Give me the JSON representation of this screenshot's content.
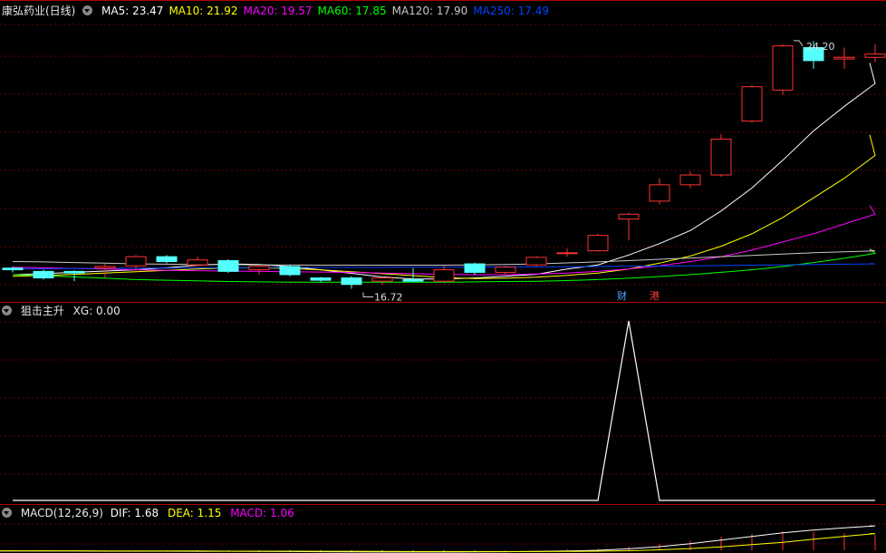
{
  "main_panel": {
    "title": "康弘药业(日线)",
    "ma_legend": [
      {
        "label": "MA5: 23.47",
        "color": "#ffffff"
      },
      {
        "label": "MA10: 21.92",
        "color": "#ffff00"
      },
      {
        "label": "MA20: 19.57",
        "color": "#ff00ff"
      },
      {
        "label": "MA60: 17.85",
        "color": "#00ff00"
      },
      {
        "label": "MA120: 17.90",
        "color": "#c8c8c8"
      },
      {
        "label": "MA250: 17.49",
        "color": "#0044ff"
      }
    ],
    "high_label": "24.20",
    "low_label": "16.72",
    "event_tags": [
      {
        "text": "财",
        "color": "#4aa8ff"
      },
      {
        "text": "港",
        "color": "#ff4040"
      }
    ]
  },
  "indicator_panel": {
    "title": "狙击主升",
    "value_label": "XG: 0.00"
  },
  "macd_panel": {
    "title": "MACD(12,26,9)",
    "dif_label": "DIF: 1.68",
    "dea_label": "DEA: 1.15",
    "macd_label": "MACD: 1.06"
  },
  "chart_data": [
    {
      "type": "candlestick",
      "title": "康弘药业(日线)",
      "price_range": [
        16.4,
        25.0
      ],
      "candles": [
        {
          "o": 17.35,
          "h": 17.4,
          "l": 17.22,
          "c": 17.3
        },
        {
          "o": 17.25,
          "h": 17.3,
          "l": 17.0,
          "c": 17.05
        },
        {
          "o": 17.25,
          "h": 17.28,
          "l": 16.95,
          "c": 17.2
        },
        {
          "o": 17.35,
          "h": 17.5,
          "l": 17.05,
          "c": 17.4
        },
        {
          "o": 17.42,
          "h": 17.75,
          "l": 17.3,
          "c": 17.7
        },
        {
          "o": 17.7,
          "h": 17.75,
          "l": 17.5,
          "c": 17.55
        },
        {
          "o": 17.45,
          "h": 17.7,
          "l": 17.4,
          "c": 17.6
        },
        {
          "o": 17.58,
          "h": 17.62,
          "l": 17.2,
          "c": 17.25
        },
        {
          "o": 17.3,
          "h": 17.45,
          "l": 17.15,
          "c": 17.4
        },
        {
          "o": 17.4,
          "h": 17.45,
          "l": 17.1,
          "c": 17.15
        },
        {
          "o": 17.05,
          "h": 17.08,
          "l": 16.92,
          "c": 16.98
        },
        {
          "o": 17.05,
          "h": 17.1,
          "l": 16.72,
          "c": 16.85
        },
        {
          "o": 16.95,
          "h": 17.1,
          "l": 16.85,
          "c": 17.05
        },
        {
          "o": 17.0,
          "h": 17.35,
          "l": 16.92,
          "c": 16.95
        },
        {
          "o": 16.95,
          "h": 17.42,
          "l": 16.88,
          "c": 17.3
        },
        {
          "o": 17.48,
          "h": 17.52,
          "l": 17.15,
          "c": 17.22
        },
        {
          "o": 17.22,
          "h": 17.42,
          "l": 17.15,
          "c": 17.38
        },
        {
          "o": 17.45,
          "h": 17.72,
          "l": 17.4,
          "c": 17.68
        },
        {
          "o": 17.8,
          "h": 17.95,
          "l": 17.7,
          "c": 17.82
        },
        {
          "o": 17.88,
          "h": 18.4,
          "l": 17.85,
          "c": 18.35
        },
        {
          "o": 18.85,
          "h": 19.05,
          "l": 18.2,
          "c": 19.0
        },
        {
          "o": 19.4,
          "h": 20.1,
          "l": 19.3,
          "c": 19.9
        },
        {
          "o": 19.9,
          "h": 20.3,
          "l": 19.8,
          "c": 20.2
        },
        {
          "o": 20.2,
          "h": 21.45,
          "l": 20.15,
          "c": 21.3
        },
        {
          "o": 21.85,
          "h": 22.95,
          "l": 21.8,
          "c": 22.9
        },
        {
          "o": 22.8,
          "h": 24.2,
          "l": 22.65,
          "c": 24.15
        },
        {
          "o": 24.1,
          "h": 24.3,
          "l": 23.45,
          "c": 23.7
        },
        {
          "o": 23.75,
          "h": 24.1,
          "l": 23.45,
          "c": 23.8
        },
        {
          "o": 23.8,
          "h": 24.2,
          "l": 23.65,
          "c": 23.9
        }
      ],
      "series": [
        {
          "name": "MA5",
          "color": "#ffffff",
          "values": [
            17.15,
            17.18,
            17.22,
            17.26,
            17.3,
            17.36,
            17.44,
            17.48,
            17.46,
            17.4,
            17.3,
            17.19,
            17.08,
            17.02,
            17.02,
            17.05,
            17.1,
            17.16,
            17.32,
            17.45,
            17.75,
            18.1,
            18.5,
            19.1,
            19.8,
            20.65,
            21.55,
            22.3,
            23.0
          ]
        },
        {
          "name": "MA10",
          "color": "#ffff00",
          "values": [
            17.1,
            17.12,
            17.16,
            17.2,
            17.24,
            17.28,
            17.32,
            17.36,
            17.36,
            17.34,
            17.3,
            17.24,
            17.18,
            17.12,
            17.06,
            17.03,
            17.04,
            17.07,
            17.13,
            17.2,
            17.32,
            17.5,
            17.72,
            18.02,
            18.4,
            18.9,
            19.5,
            20.1,
            20.8
          ]
        },
        {
          "name": "MA20",
          "color": "#ff00ff",
          "values": [
            17.38,
            17.36,
            17.34,
            17.32,
            17.3,
            17.28,
            17.27,
            17.26,
            17.25,
            17.24,
            17.23,
            17.22,
            17.2,
            17.18,
            17.16,
            17.15,
            17.15,
            17.17,
            17.2,
            17.25,
            17.32,
            17.42,
            17.55,
            17.7,
            17.9,
            18.15,
            18.4,
            18.7,
            19.0
          ]
        },
        {
          "name": "MA60",
          "color": "#00ff00",
          "values": [
            17.15,
            17.12,
            17.08,
            17.04,
            17.0,
            16.98,
            16.96,
            16.94,
            16.93,
            16.92,
            16.92,
            16.92,
            16.92,
            16.92,
            16.92,
            16.93,
            16.94,
            16.95,
            16.97,
            17.0,
            17.04,
            17.09,
            17.15,
            17.22,
            17.3,
            17.4,
            17.52,
            17.65,
            17.8
          ]
        },
        {
          "name": "MA120",
          "color": "#c8c8c8",
          "values": [
            17.55,
            17.54,
            17.52,
            17.5,
            17.48,
            17.47,
            17.46,
            17.46,
            17.45,
            17.45,
            17.44,
            17.44,
            17.44,
            17.44,
            17.44,
            17.45,
            17.46,
            17.48,
            17.51,
            17.54,
            17.58,
            17.62,
            17.66,
            17.7,
            17.74,
            17.78,
            17.82,
            17.85,
            17.88
          ]
        },
        {
          "name": "MA250",
          "color": "#0044ff",
          "values": [
            17.33,
            17.33,
            17.34,
            17.34,
            17.35,
            17.35,
            17.36,
            17.36,
            17.36,
            17.37,
            17.37,
            17.37,
            17.37,
            17.38,
            17.38,
            17.38,
            17.39,
            17.39,
            17.39,
            17.4,
            17.41,
            17.41,
            17.42,
            17.43,
            17.44,
            17.45,
            17.46,
            17.47,
            17.48
          ]
        }
      ]
    },
    {
      "type": "line",
      "title": "狙击主升",
      "series": [
        {
          "name": "XG",
          "color": "#ffffff",
          "values": [
            0,
            0,
            0,
            0,
            0,
            0,
            0,
            0,
            0,
            0,
            0,
            0,
            0,
            0,
            0,
            0,
            0,
            0,
            0,
            0,
            1,
            0,
            0,
            0,
            0,
            0,
            0,
            0,
            0
          ]
        }
      ],
      "ylim": [
        0,
        1
      ]
    },
    {
      "type": "line",
      "title": "MACD(12,26,9)",
      "series": [
        {
          "name": "DIF",
          "color": "#ffffff",
          "values": [
            -0.05,
            -0.05,
            -0.05,
            -0.06,
            -0.06,
            -0.06,
            -0.07,
            -0.07,
            -0.08,
            -0.09,
            -0.1,
            -0.11,
            -0.12,
            -0.12,
            -0.12,
            -0.11,
            -0.1,
            -0.08,
            -0.05,
            0.0,
            0.1,
            0.25,
            0.45,
            0.7,
            0.95,
            1.2,
            1.4,
            1.55,
            1.68
          ]
        },
        {
          "name": "DEA",
          "color": "#ffff00",
          "values": [
            -0.04,
            -0.04,
            -0.04,
            -0.05,
            -0.05,
            -0.05,
            -0.05,
            -0.06,
            -0.06,
            -0.06,
            -0.07,
            -0.07,
            -0.08,
            -0.09,
            -0.09,
            -0.09,
            -0.09,
            -0.09,
            -0.08,
            -0.06,
            -0.03,
            0.03,
            0.12,
            0.24,
            0.39,
            0.55,
            0.76,
            0.96,
            1.15
          ]
        }
      ]
    }
  ]
}
